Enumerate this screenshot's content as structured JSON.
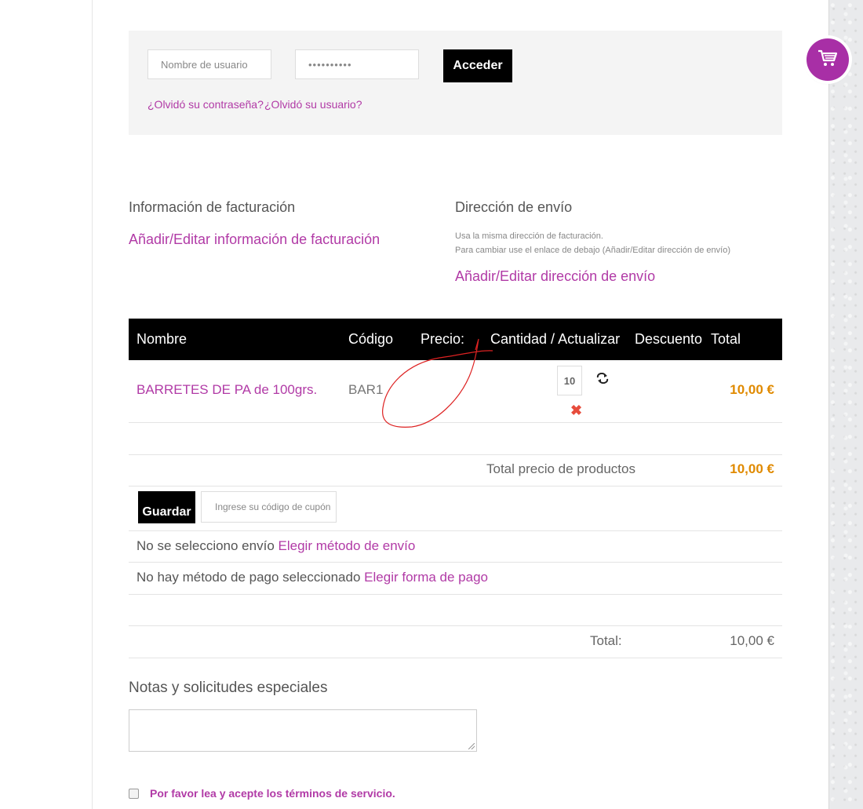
{
  "login": {
    "username_placeholder": "Nombre de usuario",
    "password_value": "••••••••••",
    "submit_label": "Acceder",
    "forgot_password": "¿Olvidó su contraseña?",
    "forgot_username": "¿Olvidó su usuario?"
  },
  "billing": {
    "title": "Información de facturación",
    "edit_link": "Añadir/Editar información de facturación"
  },
  "shipping": {
    "title": "Dirección de envío",
    "note_line1": "Usa la misma dirección de facturación.",
    "note_line2": "Para cambiar use el enlace de debajo (Añadir/Editar dirección de envío)",
    "edit_link": "Añadir/Editar dirección de envío"
  },
  "cart": {
    "headers": {
      "name": "Nombre",
      "code": "Código",
      "price": "Precio:",
      "quantity": "Cantidad / Actualizar",
      "discount": "Descuento",
      "total": "Total"
    },
    "items": [
      {
        "name": "BARRETES DE PA de 100grs.",
        "code": "BAR1",
        "quantity": "10",
        "total": "10,00 €"
      }
    ],
    "products_total_label": "Total precio de productos",
    "products_total_value": "10,00 €"
  },
  "coupon": {
    "save_label": "Guardar",
    "placeholder": "Ingrese su código de cupón"
  },
  "shipping_method": {
    "text": "No se selecciono envío",
    "link": "Elegir método de envío"
  },
  "payment_method": {
    "text": "No hay método de pago seleccionado",
    "link": "Elegir forma de pago"
  },
  "summary": {
    "total_label": "Total:",
    "total_value": "10,00 €"
  },
  "notes": {
    "title": "Notas y solicitudes especiales"
  },
  "terms": {
    "label": "Por favor lea y acepte los términos de servicio."
  },
  "colors": {
    "accent": "#b13aa6",
    "price": "#e08a00",
    "header_bg": "#000000",
    "remove": "#e74c3c",
    "fab": "#a82fa6"
  },
  "icons": {
    "refresh": "refresh-icon",
    "remove": "remove-icon",
    "cart": "shopping-cart-icon"
  }
}
